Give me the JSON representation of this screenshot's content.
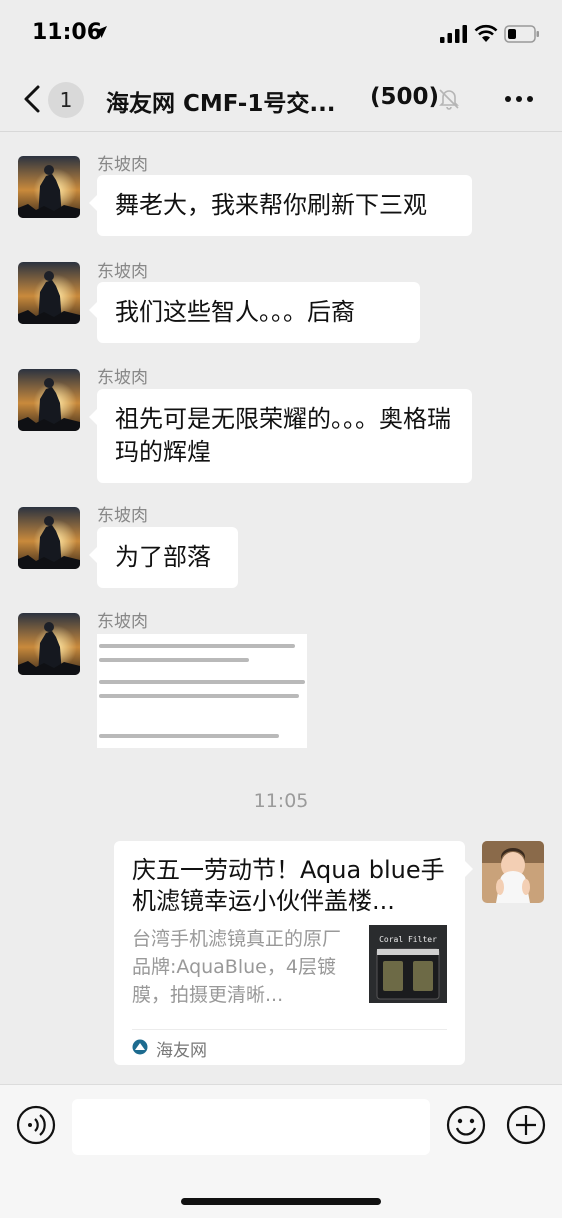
{
  "status_bar": {
    "time": "11:06",
    "icons": [
      "location-arrow-icon",
      "signal-icon",
      "wifi-icon",
      "battery-icon"
    ]
  },
  "nav": {
    "unread_count": "1",
    "title": "海友网 CMF-1号交...",
    "member_count": "(500)",
    "icons": [
      "back-icon",
      "mute-icon",
      "more-icon"
    ]
  },
  "messages": [
    {
      "sender": "东坡肉",
      "text": "舞老大，我来帮你刷新下三观"
    },
    {
      "sender": "东坡肉",
      "text": "我们这些智人。。。后裔"
    },
    {
      "sender": "东坡肉",
      "text": "祖先可是无限荣耀的。。。奥格瑞玛的辉煌"
    },
    {
      "sender": "东坡肉",
      "text": "为了部落"
    },
    {
      "sender": "东坡肉",
      "image": "text-screenshot-image"
    }
  ],
  "time_divider": "11:05",
  "card": {
    "title": "庆五一劳动节！Aqua blue手机滤镜幸运小伙伴盖楼...",
    "description": "台湾手机滤镜真正的原厂品牌:AquaBlue，4层镀膜，拍摄更清晰...",
    "thumbnail_label": "Coral Filter",
    "source": "海友网",
    "source_icon": "haiyou-logo-icon"
  },
  "input_bar": {
    "icons": [
      "voice-icon",
      "emoji-icon",
      "plus-icon"
    ],
    "input_value": ""
  },
  "colors": {
    "background": "#ededed",
    "bubble": "#ffffff",
    "sender_text": "#888888",
    "card_desc": "#999999"
  }
}
